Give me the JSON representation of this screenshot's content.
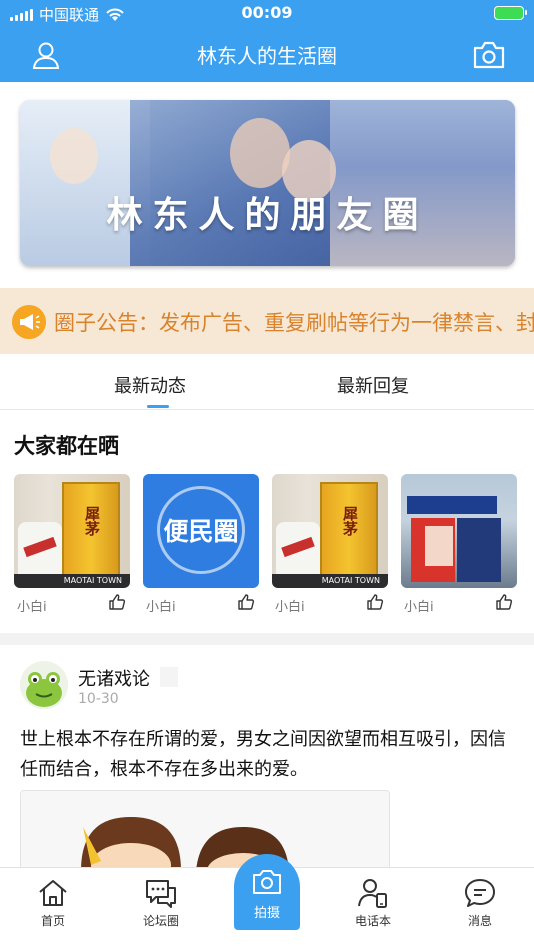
{
  "status_bar": {
    "carrier": "中国联通",
    "time": "00:09"
  },
  "nav": {
    "title": "林东人的生活圈",
    "left_icon": "user-icon",
    "right_icon": "camera-icon"
  },
  "banner": {
    "text": "林东人的朋友圈"
  },
  "notice": {
    "icon": "megaphone-icon",
    "text": "圈子公告：发布广告、重复刷帖等行为一律禁言、封号"
  },
  "tabs": [
    {
      "label": "最新动态",
      "active": true
    },
    {
      "label": "最新回复",
      "active": false
    }
  ],
  "section": {
    "title": "大家都在晒"
  },
  "thumbnails": [
    {
      "user": "小白i",
      "box_text": "犀茅",
      "base_text": "MAOTAI TOWN"
    },
    {
      "user": "小白i",
      "label": "便民圈"
    },
    {
      "user": "小白i",
      "box_text": "犀茅",
      "base_text": "MAOTAI TOWN"
    },
    {
      "user": "小白i"
    }
  ],
  "post": {
    "author": "无诸戏论",
    "date": "10-30",
    "content": "世上根本不存在所谓的爱，男女之间因欲望而相互吸引，因信任而结合，根本不存在多出来的爱。"
  },
  "tab_bar": [
    {
      "label": "首页",
      "icon": "home-icon"
    },
    {
      "label": "论坛圈",
      "icon": "forum-icon"
    },
    {
      "label": "拍摄",
      "icon": "camera-icon"
    },
    {
      "label": "电话本",
      "icon": "phonebook-icon"
    },
    {
      "label": "消息",
      "icon": "message-icon"
    }
  ],
  "colors": {
    "primary": "#3aa0ef",
    "notice_bg": "#f7e8d5",
    "notice_text": "#d9832c"
  }
}
